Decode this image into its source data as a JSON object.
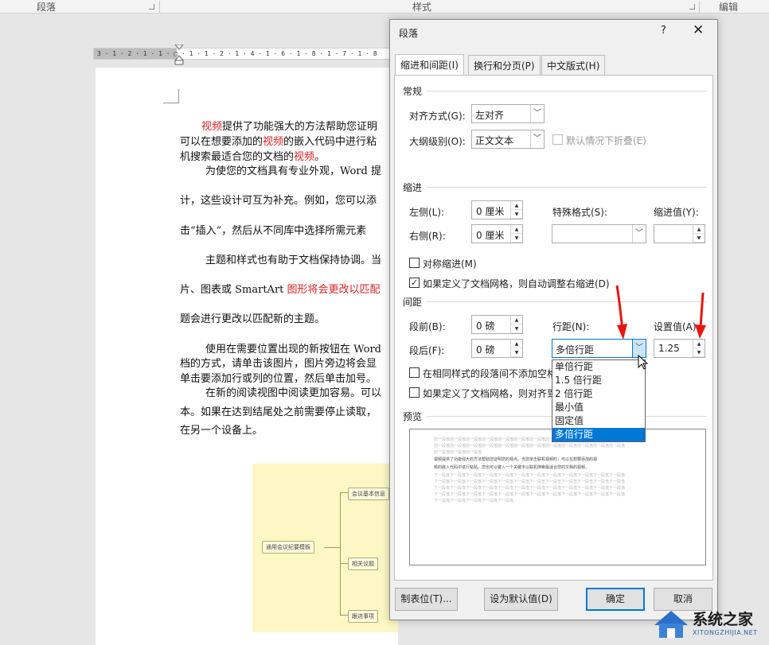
{
  "ribbon": {
    "group_paragraph": "段落",
    "group_styles": "样式",
    "group_editing": "编辑"
  },
  "ruler": {
    "ticks": "3 · 1 · 2 · 1 · 1 · ▢ · 1 · 1 · 2 · 1 · 4 · 1 · 6 · 1 · 8 · 1 · 7 · 1 · 8"
  },
  "document": {
    "p1_a": "视频",
    "p1_b": "提供了功能强大的方法帮助您证明",
    "p1_c": "可以在想要添加的",
    "p1_d": "视频",
    "p1_e": "的嵌入代码中进行粘",
    "p1_f": "机搜索最适合您的文档的",
    "p1_g": "视频",
    "p1_h": "。",
    "p2": "为使您的文档具有专业外观，Word 提",
    "p3": "计，这些设计可互为补充。例如，您可以添",
    "p4": "击“插入”，然后从不同库中选择所需元素",
    "p5": "主题和样式也有助于文档保持协调。当",
    "p6_a": "片、图表或 SmartArt ",
    "p6_b": "图形将会更改以匹配",
    "p7": "题会进行更改以匹配新的主题。",
    "p8": "使用在需要位置出现的新按钮在 Word",
    "p9": "档的方式，请单击该图片，图片旁边将会显",
    "p10": "单击要添加行或列的位置，然后单击加号。",
    "p11": "在新的阅读视图中阅读更加容易。可以",
    "p12": "本。如果在达到结尾处之前需要停止读取，",
    "p13": "在另一个设备上。"
  },
  "mindmap": {
    "root": "通用会议纪要模板",
    "n1": "会议基本信息",
    "n2": "相关议题",
    "n3": "跟进事项"
  },
  "dialog": {
    "title": "段落",
    "help": "?",
    "close": "✕",
    "tabs": [
      "缩进和间距(I)",
      "换行和分页(P)",
      "中文版式(H)"
    ],
    "general": {
      "heading": "常规",
      "alignment_label": "对齐方式(G):",
      "alignment_value": "左对齐",
      "outline_label": "大纲级别(O):",
      "outline_value": "正文文本",
      "collapse_label": "默认情况下折叠(E)"
    },
    "indent": {
      "heading": "缩进",
      "left_label": "左侧(L):",
      "left_value": "0 厘米",
      "right_label": "右侧(R):",
      "right_value": "0 厘米",
      "special_label": "特殊格式(S):",
      "special_value": "",
      "by_label": "缩进值(Y):",
      "by_value": "",
      "mirror_label": "对称缩进(M)",
      "auto_adjust_label": "如果定义了文档网格，则自动调整右缩进(D)"
    },
    "spacing": {
      "heading": "间距",
      "before_label": "段前(B):",
      "before_value": "0 磅",
      "after_label": "段后(F):",
      "after_value": "0 磅",
      "line_label": "行距(N):",
      "line_value": "多倍行距",
      "at_label": "设置值(A):",
      "at_value": "1.25",
      "no_space_label": "在相同样式的段落间不添加空格",
      "snap_label": "如果定义了文档网格，则对齐到"
    },
    "line_options": [
      "单倍行距",
      "1.5 倍行距",
      "2 倍行距",
      "最小值",
      "固定值",
      "多倍行距"
    ],
    "preview": {
      "heading": "预览",
      "prev_lines": [
        "前一段落前一段落前一段落前一段落前一段落前一段落前一段落前一段落前一段落前一段落前一段落前一段落",
        "前一段落前一段落前一段落前一段落前一段落前一段落前一段落前一段落前一段落前一段落前一段落前一段落",
        "前一段落前一段落前一段落"
      ],
      "main_lines": [
        "视频提供了功能强大的方法帮助您证明您的观点。当您单击联机视频时，可以在想要添加的视",
        "频的嵌入代码中进行粘贴。您也可以键入一个关键字以联机搜索最适合您的文档的视频。"
      ],
      "next_lines": [
        "下一段落下一段落下一段落下一段落下一段落下一段落下一段落下一段落下一段落下一段落下一段落下一段落",
        "下一段落下一段落下一段落下一段落下一段落下一段落下一段落下一段落下一段落下一段落下一段落下一段落",
        "下一段落下一段落下一段落下一段落下一段落下一段落下一段落下一段落下一段落下一段落下一段落下一段落",
        "下一段落下一段落下一段落下一段落下一段落下一段落下一段落下一段落下一段落下一段落下一段落下一段落",
        "下一段落下一段落下一段落下一段落下一段落"
      ]
    },
    "buttons": {
      "tabs": "制表位(T)...",
      "default": "设为默认值(D)",
      "ok": "确定",
      "cancel": "取消"
    }
  },
  "watermark": {
    "text": "系统之家",
    "sub": "XITONGZHIJIA.NET"
  },
  "colors": {
    "accent": "#0078d7",
    "annotation_arrow": "#e8150f",
    "doc_highlight": "#e02020"
  }
}
